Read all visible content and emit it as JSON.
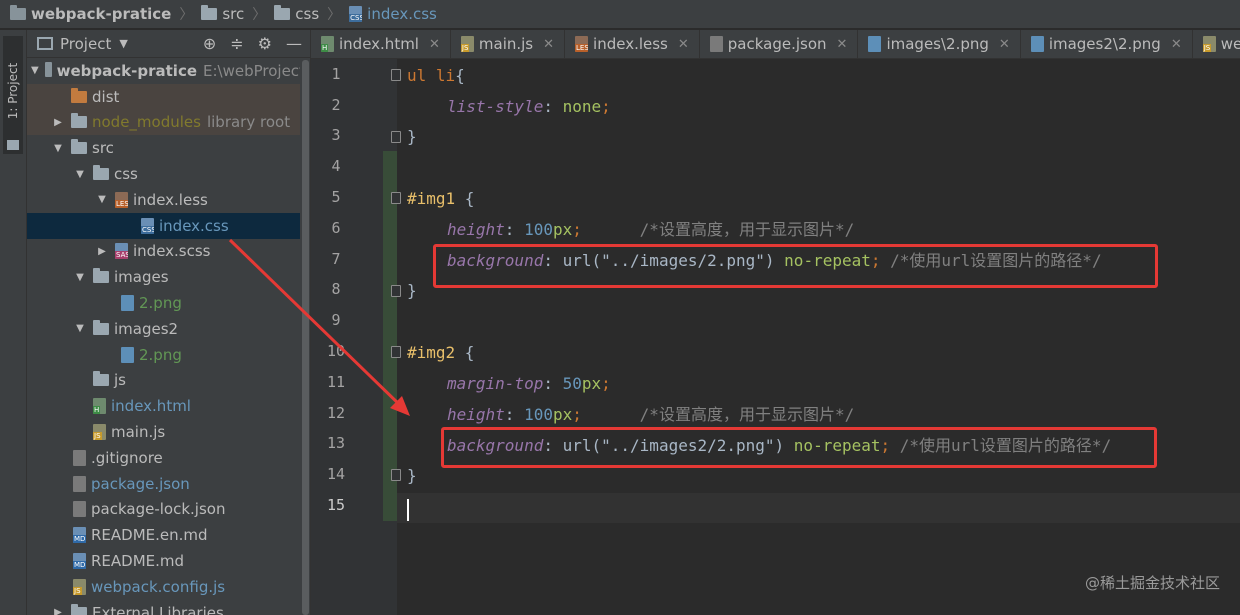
{
  "breadcrumb": {
    "items": [
      "webpack-pratice",
      "src",
      "css",
      "index.css"
    ]
  },
  "left_strip": {
    "label": "1: Project"
  },
  "project_panel": {
    "title": "Project",
    "tree": [
      {
        "label": "webpack-pratice",
        "extra": "E:\\webProject\\"
      },
      {
        "label": "dist"
      },
      {
        "label": "node_modules",
        "extra": "library root"
      },
      {
        "label": "src"
      },
      {
        "label": "css"
      },
      {
        "label": "index.less"
      },
      {
        "label": "index.css"
      },
      {
        "label": "index.scss"
      },
      {
        "label": "images"
      },
      {
        "label": "2.png"
      },
      {
        "label": "images2"
      },
      {
        "label": "2.png"
      },
      {
        "label": "js"
      },
      {
        "label": "index.html"
      },
      {
        "label": "main.js"
      },
      {
        "label": ".gitignore"
      },
      {
        "label": "package.json"
      },
      {
        "label": "package-lock.json"
      },
      {
        "label": "README.en.md"
      },
      {
        "label": "README.md"
      },
      {
        "label": "webpack.config.js"
      },
      {
        "label": "External Libraries"
      }
    ]
  },
  "tabs": [
    {
      "label": "index.html"
    },
    {
      "label": "main.js"
    },
    {
      "label": "index.less"
    },
    {
      "label": "package.json"
    },
    {
      "label": "images\\2.png"
    },
    {
      "label": "images2\\2.png"
    },
    {
      "label": "webp"
    }
  ],
  "editor": {
    "line_numbers": [
      "1",
      "2",
      "3",
      "4",
      "5",
      "6",
      "7",
      "8",
      "9",
      "10",
      "11",
      "12",
      "13",
      "14",
      "15"
    ],
    "code": {
      "l1_sel": "ul li",
      "l1_brace": "{",
      "l2_prop": "list-style",
      "l2_val": "none",
      "l3": "}",
      "l5_sel": "#img1",
      "l5_brace": " {",
      "l6_prop": "height",
      "l6_num": "100",
      "l6_unit": "px",
      "l6_cmt": "/*设置高度，用于显示图片*/",
      "l7_prop": "background",
      "l7_fn": "url",
      "l7_str": "\"../images/2.png\"",
      "l7_kw": "no-repeat",
      "l7_cmt": "/*使用url设置图片的路径*/",
      "l8": "}",
      "l10_sel": "#img2",
      "l10_brace": " {",
      "l11_prop": "margin-top",
      "l11_num": "50",
      "l11_unit": "px",
      "l12_prop": "height",
      "l12_num": "100",
      "l12_unit": "px",
      "l12_cmt": "/*设置高度，用于显示图片*/",
      "l13_prop": "background",
      "l13_fn": "url",
      "l13_str": "\"../images2/2.png\"",
      "l13_kw": "no-repeat",
      "l13_cmt": "/*使用url设置图片的路径*/",
      "l14": "}"
    }
  },
  "watermark": "@稀土掘金技术社区",
  "colors": {
    "annotation_red": "#e53935",
    "selection": "#0d293e",
    "accent": "#4a88c7"
  }
}
